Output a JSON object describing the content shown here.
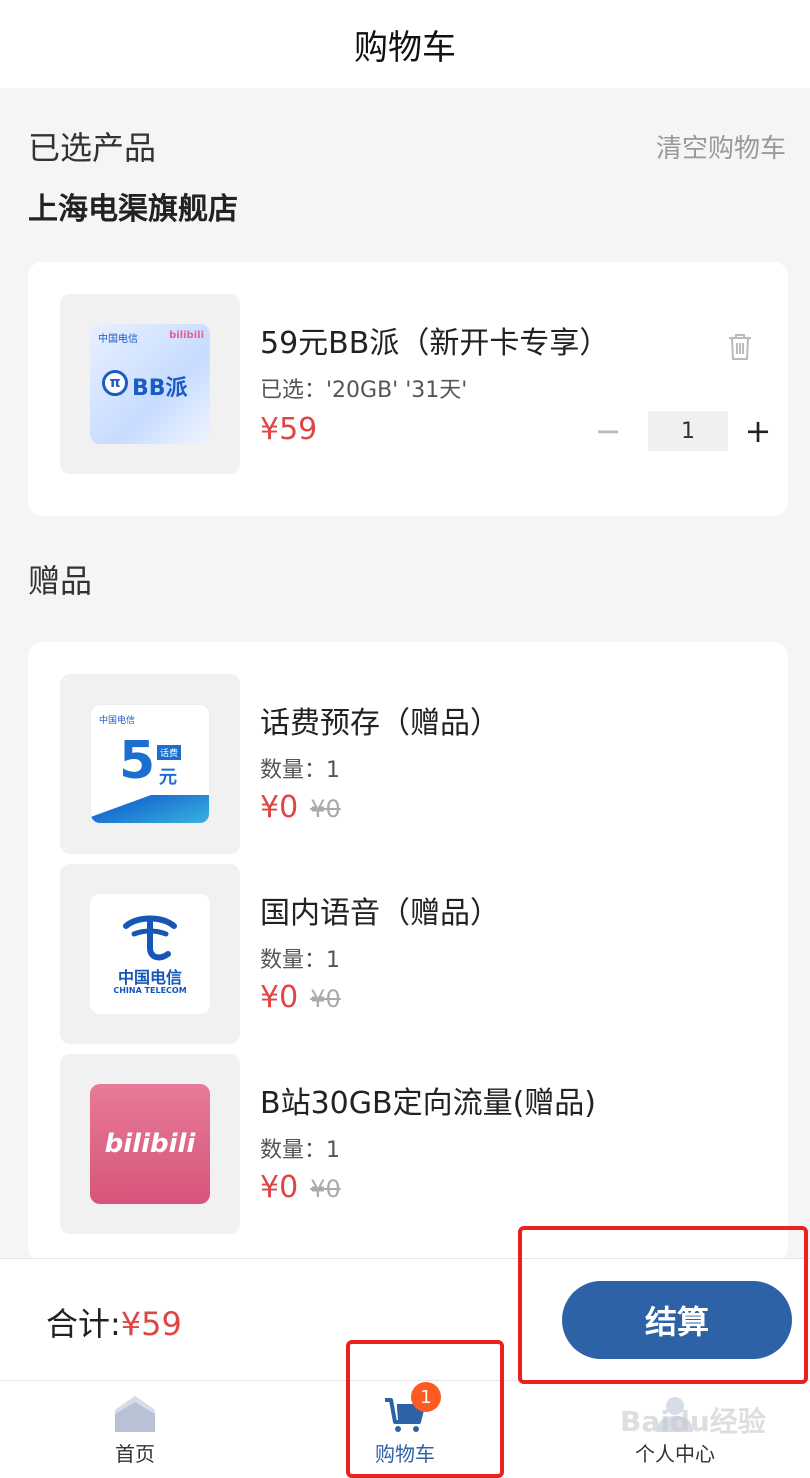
{
  "header": {
    "title": "购物车"
  },
  "cart": {
    "section_label": "已选产品",
    "clear_label": "清空购物车",
    "store_name": "上海电渠旗舰店",
    "product": {
      "name": "59元BB派（新开卡专享）",
      "selected": "已选：'20GB' '31天'",
      "price": "¥59",
      "quantity": "1",
      "minus": "−",
      "plus": "+",
      "thumb_text": "BB派",
      "thumb_brand": "中国电信",
      "thumb_partner": "bilibili"
    }
  },
  "gifts": {
    "section_label": "赠品",
    "items": [
      {
        "name": "话费预存（赠品）",
        "qty": "数量：1",
        "price": "¥0",
        "original": "¥0",
        "thumb_text": "5",
        "thumb_unit": "元",
        "thumb_tag": "话费",
        "thumb_brand": "中国电信"
      },
      {
        "name": "国内语音（赠品）",
        "qty": "数量：1",
        "price": "¥0",
        "original": "¥0",
        "thumb_text": "中国电信",
        "thumb_sub": "CHINA TELECOM"
      },
      {
        "name": "B站30GB定向流量(赠品)",
        "qty": "数量：1",
        "price": "¥0",
        "original": "¥0",
        "thumb_text": "bilibili"
      }
    ]
  },
  "footer": {
    "total_label": "合计:",
    "total_amount": "¥59",
    "checkout_label": "结算"
  },
  "tabbar": {
    "tabs": [
      {
        "label": "首页"
      },
      {
        "label": "购物车",
        "badge": "1"
      },
      {
        "label": "个人中心"
      }
    ]
  },
  "watermark": "Baidu经验",
  "colors": {
    "accent": "#2d63a6",
    "price": "#e04545",
    "badge": "#ff5a1f",
    "annotation": "#e8221c"
  }
}
